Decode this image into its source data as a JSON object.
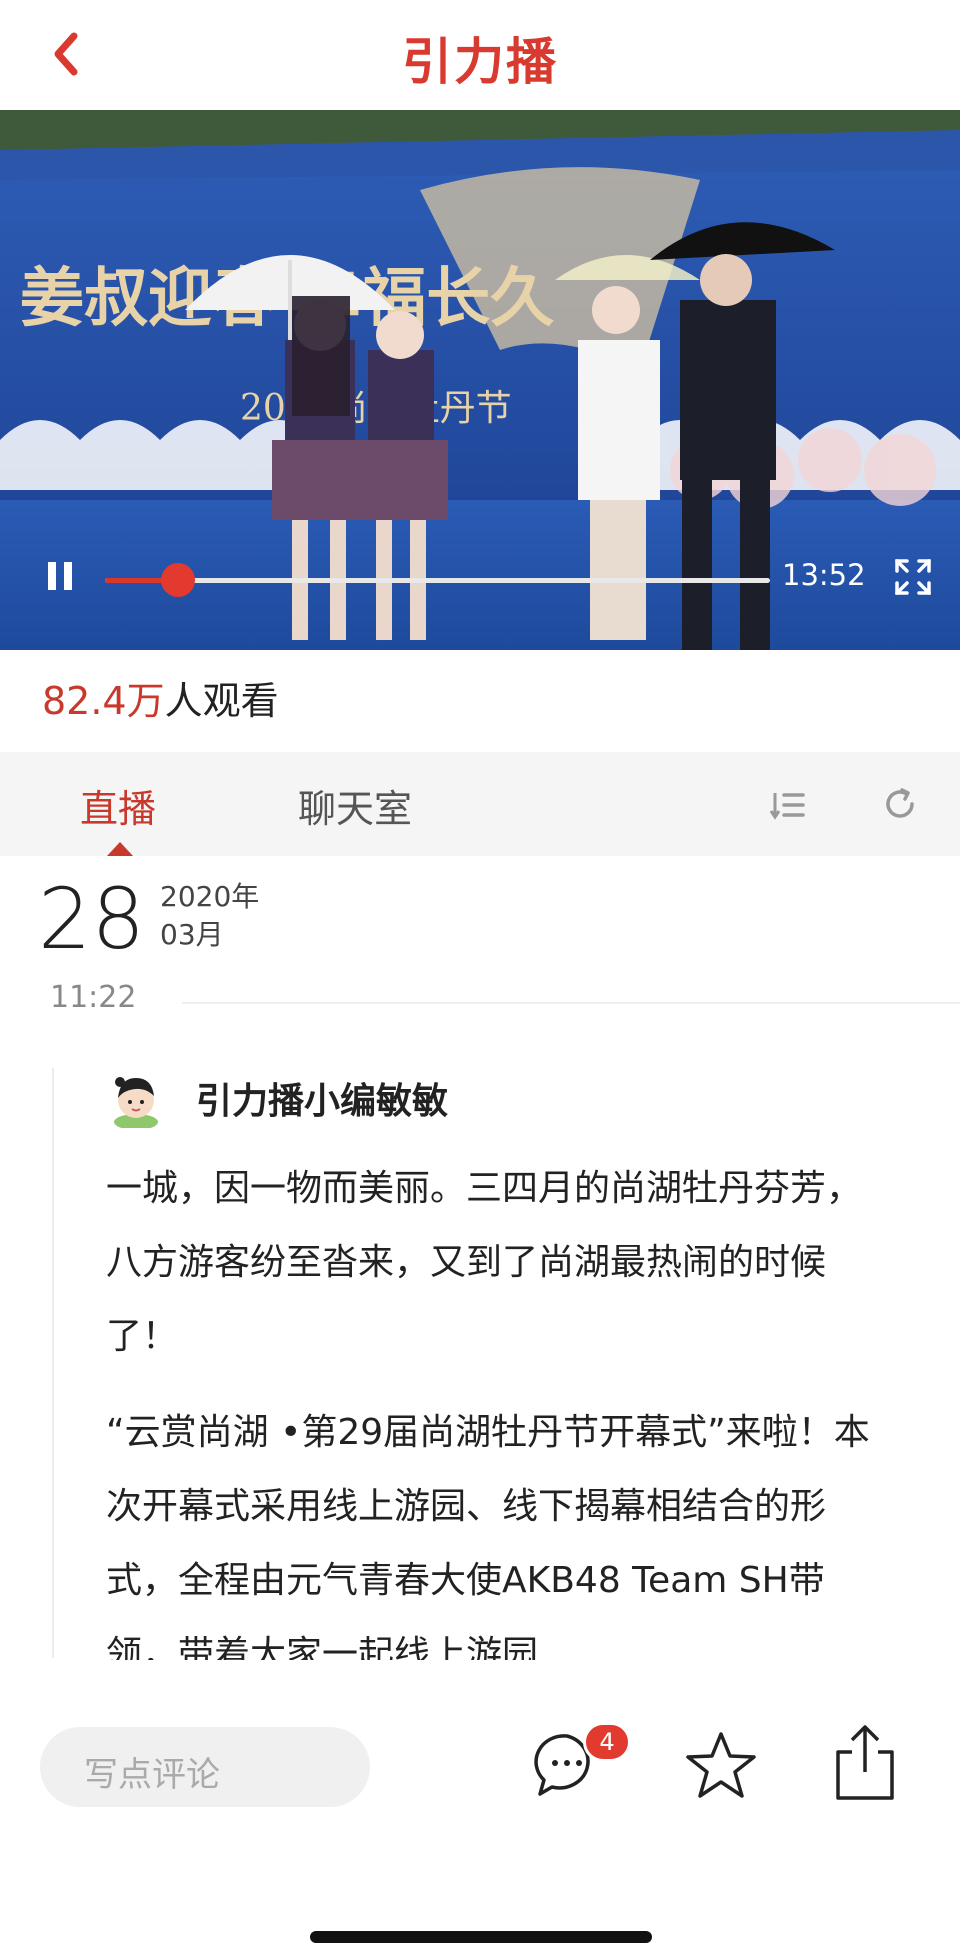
{
  "header": {
    "logo": "引力播"
  },
  "video": {
    "banner_text": "姜叔迎春 幸福长久",
    "banner_sub": "2020尚湖牡丹节",
    "time": "13:52",
    "progress": 0.11
  },
  "viewers": {
    "count": "82.4万",
    "suffix": "人观看"
  },
  "tabs": [
    {
      "label": "直播"
    },
    {
      "label": "聊天室"
    }
  ],
  "date": {
    "day": "28",
    "year": "2020年",
    "month": "03月",
    "time": "11:22"
  },
  "post": {
    "author": "引力播小编敏敏",
    "paragraphs": [
      "一城，因一物而美丽。三四月的尚湖牡丹芬芳，八方游客纷至沓来，又到了尚湖最热闹的时候了！",
      "“云赏尚湖 •第29届尚湖牡丹节开幕式”来啦！本次开幕式采用线上游园、线下揭幕相结合的形式，全程由元气青春大使AKB48 Team SH带领，带着大家一起线上游园"
    ]
  },
  "bottom": {
    "comment_placeholder": "写点评论",
    "comment_count": "4"
  },
  "colors": {
    "accent": "#c8392c",
    "badge": "#e23a2f"
  }
}
